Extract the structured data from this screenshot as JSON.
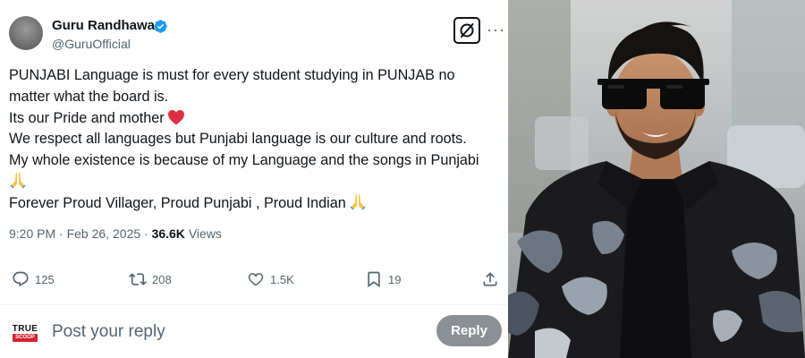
{
  "tweet": {
    "author": {
      "name": "Guru Randhawa",
      "handle": "@GuruOfficial",
      "verified": true
    },
    "lines": [
      "PUNJABI Language is  must for every student studying in PUNJAB no",
      "matter what the board is.",
      "Its our Pride and mother",
      "We respect all languages but Punjabi language is our culture and roots.",
      "My whole existence is because of my Language and the songs in Punjabi",
      "",
      "Forever Proud Villager, Proud Punjabi , Proud Indian"
    ],
    "emojis": [
      "red-heart",
      "folded-hands",
      "folded-hands"
    ],
    "meta": {
      "time": "9:20 PM",
      "separator": "·",
      "date": "Feb 26, 2025",
      "views_count": "36.6K",
      "views_label": "Views"
    },
    "actions": {
      "replies": "125",
      "reposts": "208",
      "likes": "1.5K",
      "bookmarks": "19"
    }
  },
  "reply": {
    "avatar_line1": "TRUE",
    "avatar_line2": "SCOOP",
    "placeholder": "Post your reply",
    "button_label": "Reply"
  },
  "colors": {
    "verified": "#1d9bf0",
    "text": "#0f1419",
    "secondary": "#536471",
    "reply_button": "#8b9096"
  },
  "icons": [
    "verified-badge-icon",
    "grok-icon",
    "more-icon",
    "reply-icon",
    "repost-icon",
    "like-icon",
    "bookmark-icon",
    "share-icon"
  ]
}
